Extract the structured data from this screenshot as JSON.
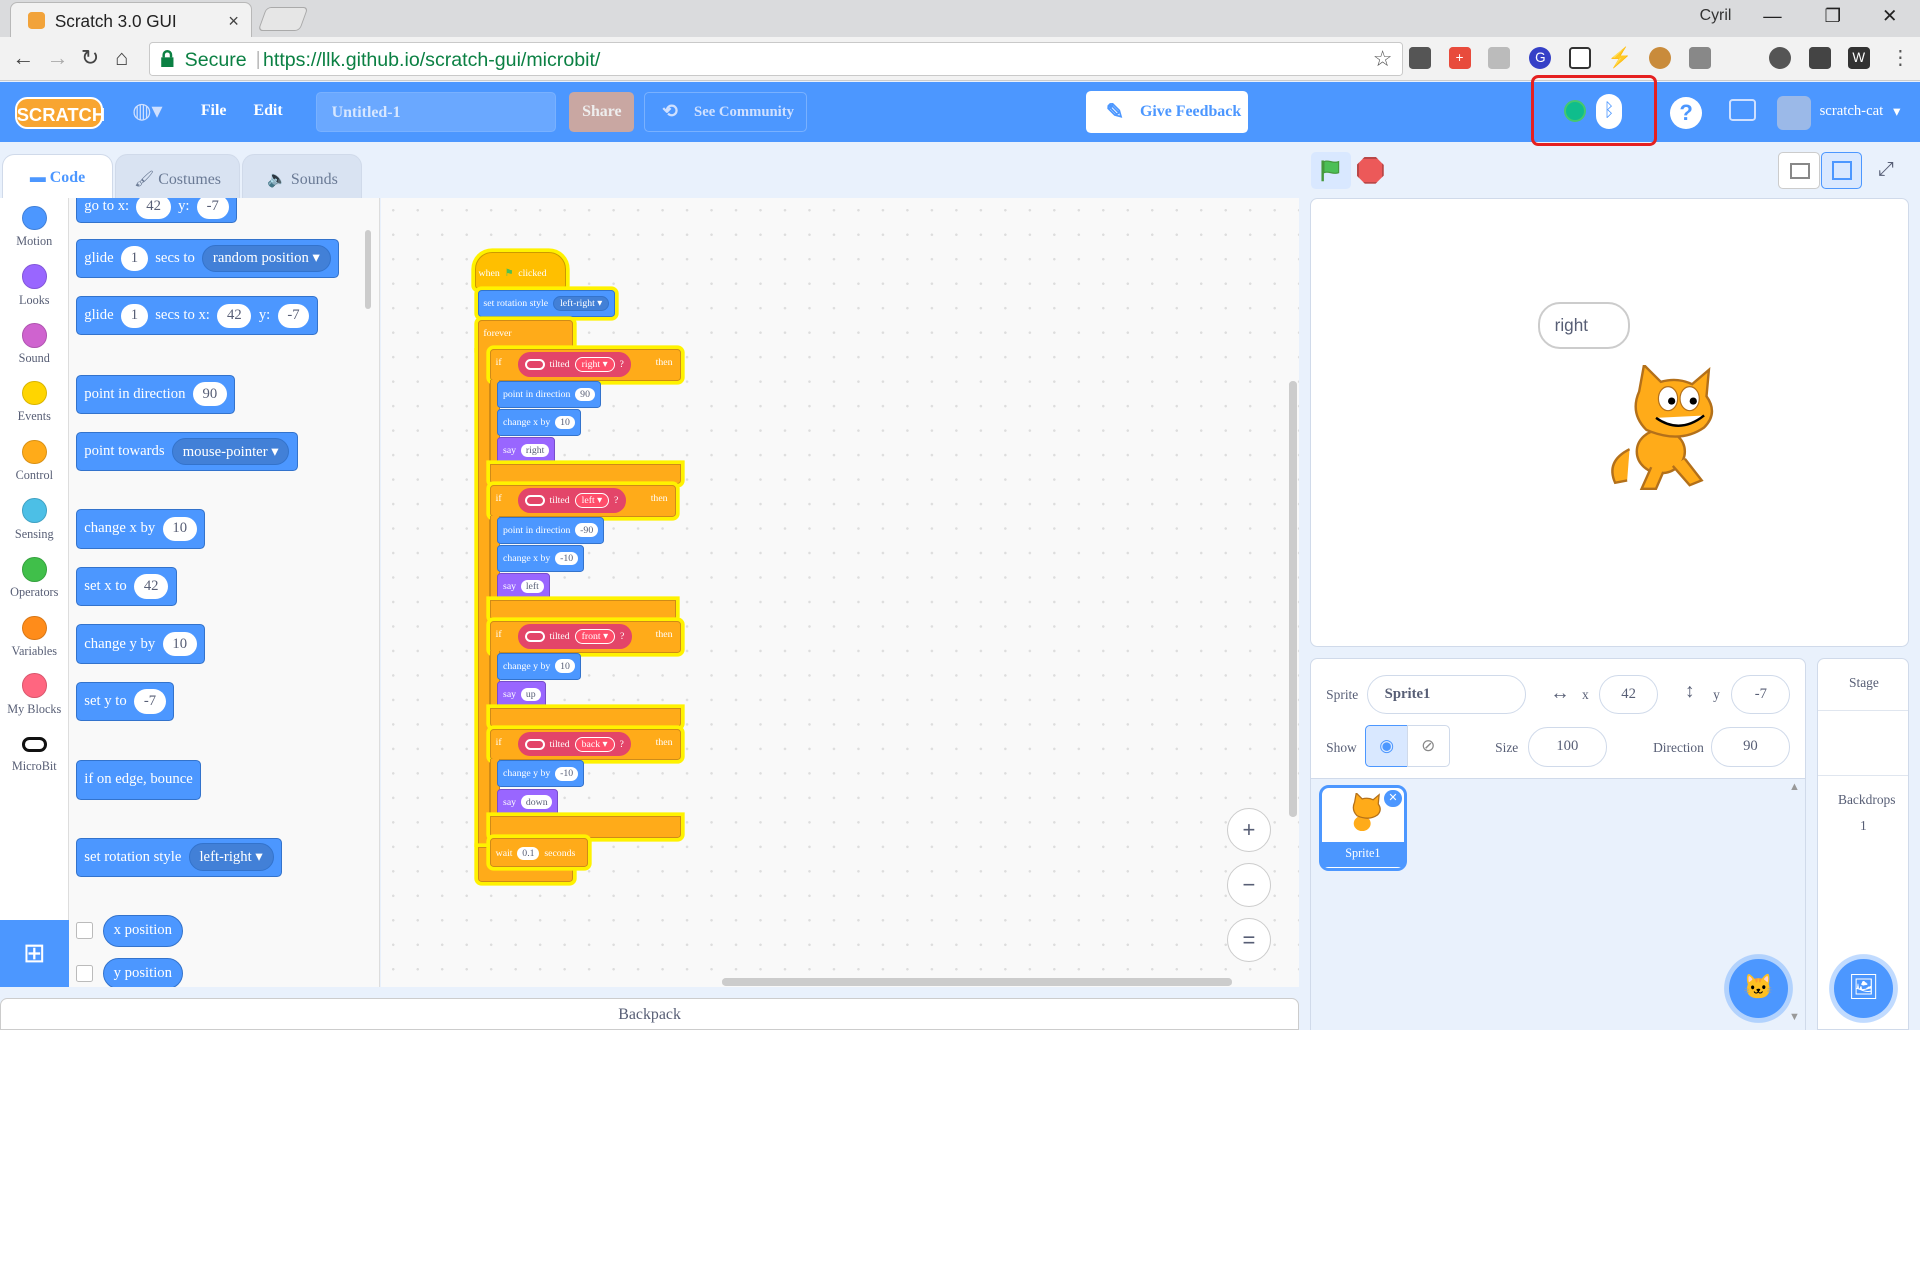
{
  "browser": {
    "tab_title": "Scratch 3.0 GUI",
    "tab_close": "×",
    "user": "Cyril",
    "secure_label": "Secure",
    "url": "https://llk.github.io/scratch-gui/microbit/"
  },
  "menu": {
    "logo": "SCRATCH",
    "file": "File",
    "edit": "Edit",
    "project_title": "Untitled-1",
    "share": "Share",
    "see_community": "See Community",
    "give_feedback": "Give Feedback",
    "username": "scratch-cat",
    "help": "?"
  },
  "tabs": {
    "code": "Code",
    "costumes": "Costumes",
    "sounds": "Sounds"
  },
  "categories": [
    {
      "name": "Motion",
      "color": "#4c97ff"
    },
    {
      "name": "Looks",
      "color": "#9966ff"
    },
    {
      "name": "Sound",
      "color": "#cf63cf"
    },
    {
      "name": "Events",
      "color": "#ffd500"
    },
    {
      "name": "Control",
      "color": "#ffab19"
    },
    {
      "name": "Sensing",
      "color": "#4cbfe6"
    },
    {
      "name": "Operators",
      "color": "#40bf4a"
    },
    {
      "name": "Variables",
      "color": "#ff8c1a"
    },
    {
      "name": "My Blocks",
      "color": "#ff6680"
    },
    {
      "name": "MicroBit",
      "color": "#111111"
    }
  ],
  "palette": {
    "goto_text": "go to x:",
    "goto_x": "42",
    "goto_y_label": "y:",
    "goto_y": "-7",
    "glide1_a": "glide",
    "glide1_secs": "1",
    "glide1_b": "secs to",
    "glide1_target": "random position",
    "glide2_a": "glide",
    "glide2_secs": "1",
    "glide2_b": "secs to x:",
    "glide2_x": "42",
    "glide2_yl": "y:",
    "glide2_y": "-7",
    "point_dir": "point in direction",
    "point_dir_val": "90",
    "point_towards": "point towards",
    "point_towards_val": "mouse-pointer",
    "change_x": "change x by",
    "change_x_val": "10",
    "set_x": "set x to",
    "set_x_val": "42",
    "change_y": "change y by",
    "change_y_val": "10",
    "set_y": "set y to",
    "set_y_val": "-7",
    "bounce": "if on edge, bounce",
    "rot_style": "set rotation style",
    "rot_style_val": "left-right",
    "x_position": "x position",
    "y_position": "y position"
  },
  "script": {
    "hat_when": "when",
    "hat_clicked": "clicked",
    "set_rot": "set rotation style",
    "set_rot_val": "left-right",
    "forever": "forever",
    "if_label": "if",
    "tilted": "tilted",
    "then": "then",
    "q": "?",
    "branch1": {
      "dir": "right",
      "point": "point in direction",
      "point_val": "90",
      "change": "change x by",
      "change_val": "10",
      "say": "say",
      "say_val": "right"
    },
    "branch2": {
      "dir": "left",
      "point": "point in direction",
      "point_val": "-90",
      "change": "change x by",
      "change_val": "-10",
      "say": "say",
      "say_val": "left"
    },
    "branch3": {
      "dir": "front",
      "change": "change y by",
      "change_val": "10",
      "say": "say",
      "say_val": "up"
    },
    "branch4": {
      "dir": "back",
      "change": "change y by",
      "change_val": "-10",
      "say": "say",
      "say_val": "down"
    },
    "wait": "wait",
    "wait_val": "0.1",
    "seconds": "seconds"
  },
  "workspace": {
    "zoom_in": "+",
    "zoom_out": "−",
    "reset": "="
  },
  "backpack": "Backpack",
  "stage": {
    "speech": "right"
  },
  "sprite_info": {
    "sprite_label": "Sprite",
    "sprite_name": "Sprite1",
    "x_label": "x",
    "x": "42",
    "y_label": "y",
    "y": "-7",
    "show_label": "Show",
    "size_label": "Size",
    "size": "100",
    "direction_label": "Direction",
    "direction": "90"
  },
  "sprites": [
    {
      "name": "Sprite1"
    }
  ],
  "stage_panel": {
    "title": "Stage",
    "backdrops_label": "Backdrops",
    "backdrops_count": "1"
  }
}
